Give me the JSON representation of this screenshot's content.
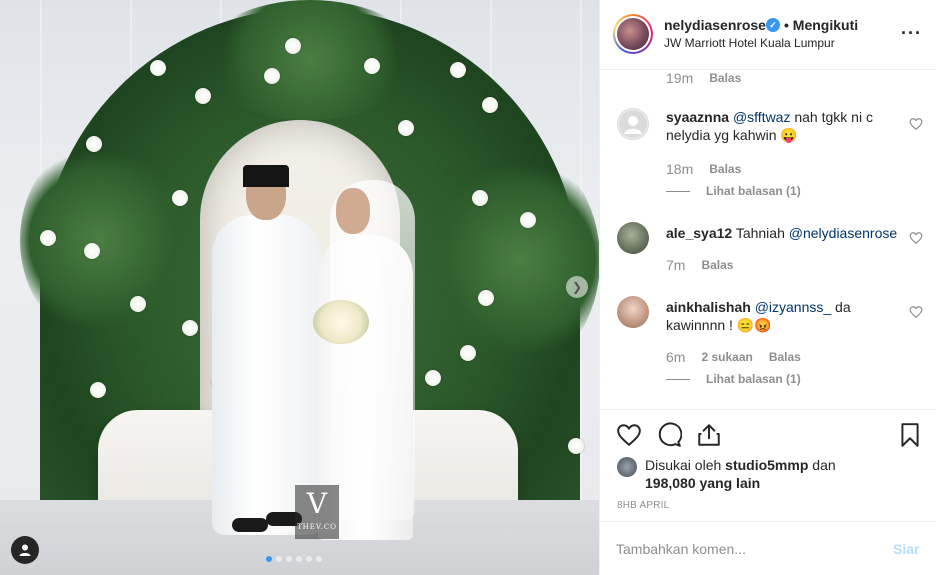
{
  "post": {
    "author": {
      "username": "nelydiasenrose",
      "follow_status": "• Mengikuti",
      "location": "JW Marriott Hotel Kuala Lumpur"
    },
    "more_icon": "more-horizontal-icon",
    "watermark": {
      "letter": "V",
      "text": "THEV.CO"
    },
    "carousel": {
      "count": 6,
      "active_index": 0
    }
  },
  "comments": {
    "partial_top": {
      "time": "19m",
      "reply": "Balas"
    },
    "items": [
      {
        "username": "syaaznna",
        "mention": "@sfftwaz",
        "text": " nah tgkk ni c nelydia yg kahwin 😛",
        "time": "18m",
        "reply": "Balas",
        "view_replies": "Lihat balasan (1)"
      },
      {
        "username": "ale_sya12",
        "text": " Tahniah ",
        "mention": "@nelydiasenrose",
        "time": "7m",
        "reply": "Balas"
      },
      {
        "username": "ainkhalishah",
        "mention": "@izyannss_",
        "text": " da kawinnnn ! 😑😡",
        "time": "6m",
        "likes": "2 sukaan",
        "reply": "Balas",
        "view_replies": "Lihat balasan (1)"
      }
    ]
  },
  "actions": {
    "icons": [
      "heart-icon",
      "comment-icon",
      "share-icon",
      "bookmark-icon"
    ],
    "liked_by_prefix": "Disukai oleh",
    "liked_by_user": "studio5mmp",
    "liked_by_conj": "dan",
    "liked_by_others": "198,080 yang lain",
    "date": "8HB APRIL"
  },
  "composer": {
    "placeholder": "Tambahkan komen...",
    "post_label": "Siar"
  },
  "colors": {
    "link": "#003569",
    "verified": "#3897f0",
    "muted": "#8e8e8e",
    "post_disabled": "#b2dffc"
  }
}
